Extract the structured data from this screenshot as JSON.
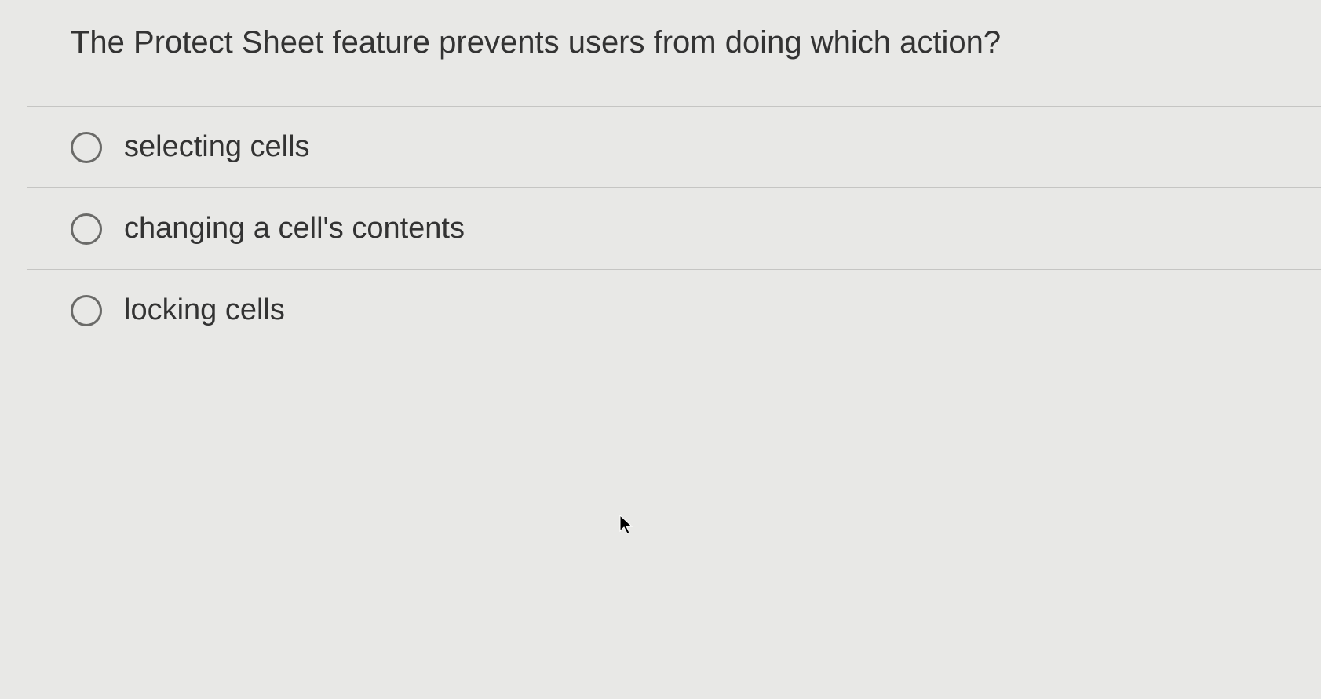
{
  "question": {
    "text": "The Protect Sheet feature prevents users from doing which action?"
  },
  "options": [
    {
      "label": "selecting cells"
    },
    {
      "label": "changing a cell's contents"
    },
    {
      "label": "locking cells"
    }
  ]
}
